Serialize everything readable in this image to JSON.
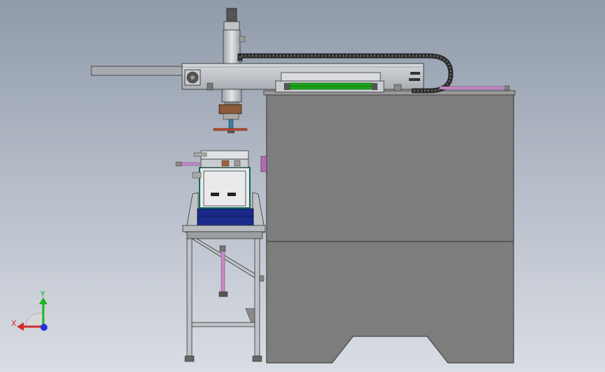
{
  "triad": {
    "y_label": "Y",
    "x_label": "X",
    "colors": {
      "y": "#1db31d",
      "x": "#d42a2a",
      "z": "#2233dd"
    }
  },
  "palette": {
    "cabinet": "#7d7d7d",
    "frame": "#bfc3c8",
    "bin": "#1b2a8a",
    "belt_green": "#1aa51a",
    "cable_chain": "#2a2a2a",
    "tube_pink": "#c88ac8"
  }
}
